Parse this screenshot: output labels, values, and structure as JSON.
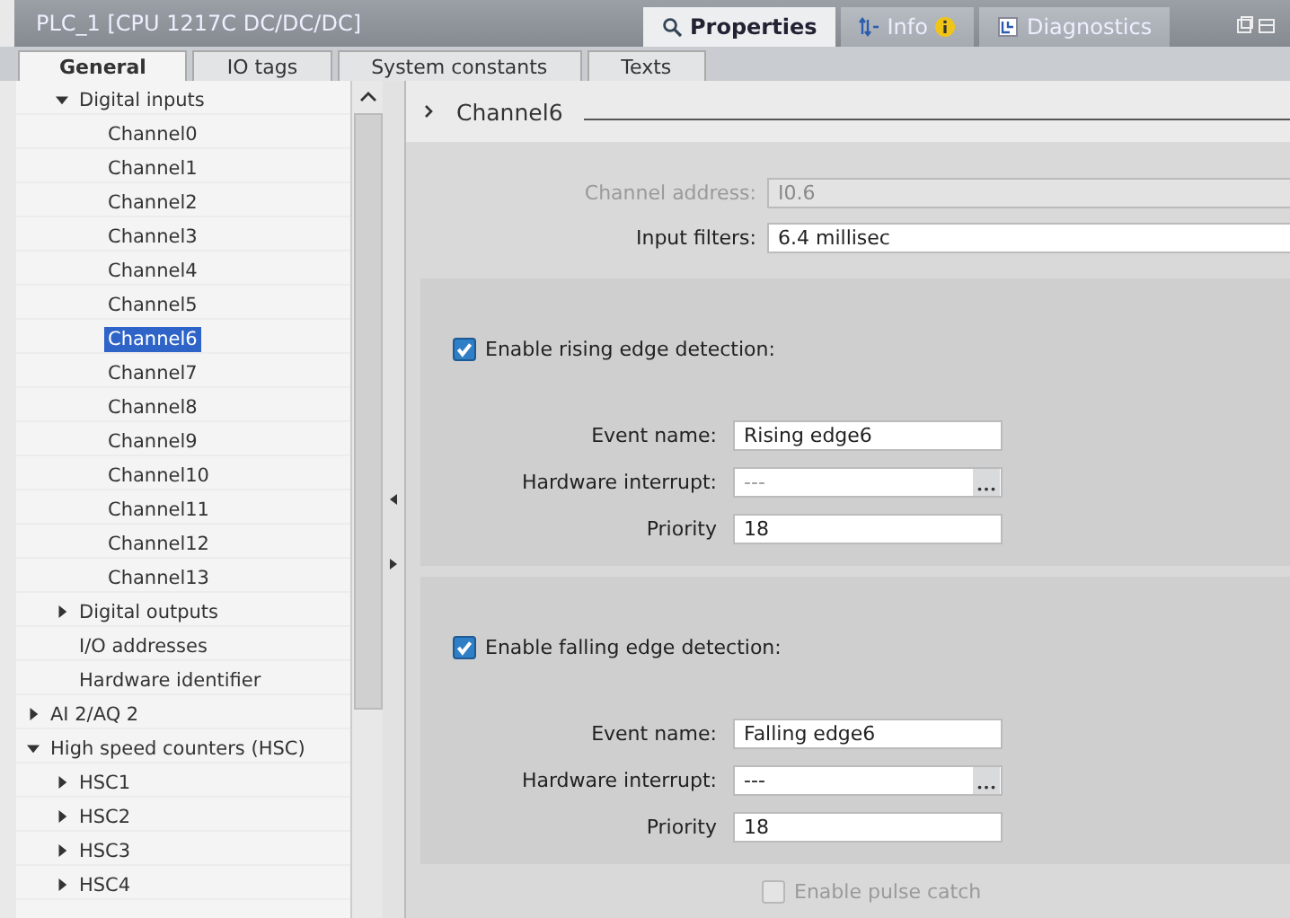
{
  "window": {
    "title": "PLC_1 [CPU 1217C DC/DC/DC]"
  },
  "inspector_tabs": [
    {
      "label": "Properties",
      "selected": true,
      "kind": "search"
    },
    {
      "label": "Info",
      "selected": false,
      "kind": "info"
    },
    {
      "label": "Diagnostics",
      "selected": false,
      "kind": "diag"
    }
  ],
  "tabs": [
    {
      "label": "General",
      "selected": true
    },
    {
      "label": "IO tags",
      "selected": false
    },
    {
      "label": "System constants",
      "selected": false
    },
    {
      "label": "Texts",
      "selected": false
    }
  ],
  "tree": {
    "items": [
      {
        "children": [
          {
            "label": "Digital inputs",
            "expanded": true,
            "selected": false,
            "children": [
              {
                "label": "Channel0",
                "selected": false
              },
              {
                "label": "Channel1",
                "selected": false
              },
              {
                "label": "Channel2",
                "selected": false
              },
              {
                "label": "Channel3",
                "selected": false
              },
              {
                "label": "Channel4",
                "selected": false
              },
              {
                "label": "Channel5",
                "selected": false
              },
              {
                "label": "Channel6",
                "selected": true
              },
              {
                "label": "Channel7",
                "selected": false
              },
              {
                "label": "Channel8",
                "selected": false
              },
              {
                "label": "Channel9",
                "selected": false
              },
              {
                "label": "Channel10",
                "selected": false
              },
              {
                "label": "Channel11",
                "selected": false
              },
              {
                "label": "Channel12",
                "selected": false
              },
              {
                "label": "Channel13",
                "selected": false
              }
            ]
          },
          {
            "label": "Digital outputs",
            "expanded": false,
            "selected": false
          },
          {
            "label": "I/O addresses",
            "selected": false
          },
          {
            "label": "Hardware identifier",
            "selected": false
          }
        ]
      },
      {
        "label": "AI 2/AQ 2",
        "expanded": false,
        "selected": false
      },
      {
        "label": "High speed counters (HSC)",
        "expanded": true,
        "selected": false,
        "children": [
          {
            "label": "HSC1",
            "expanded": false,
            "selected": false
          },
          {
            "label": "HSC2",
            "expanded": false,
            "selected": false
          },
          {
            "label": "HSC3",
            "expanded": false,
            "selected": false
          },
          {
            "label": "HSC4",
            "expanded": false,
            "selected": false
          }
        ]
      }
    ]
  },
  "section": {
    "title": "Channel6",
    "channel_address": {
      "label": "Channel address:",
      "value": "I0.6",
      "disabled": true
    },
    "input_filters": {
      "label": "Input filters:",
      "value": "6.4 millisec"
    },
    "groups": [
      {
        "checkbox": {
          "label": "Enable rising edge detection:",
          "checked": true
        },
        "event_name": {
          "label": "Event name:",
          "value": "Rising edge6"
        },
        "hardware_interrupt": {
          "label": "Hardware interrupt:",
          "value": "---",
          "disabled": true
        },
        "priority": {
          "label": "Priority",
          "value": "18"
        }
      },
      {
        "checkbox": {
          "label": "Enable falling edge detection:",
          "checked": true
        },
        "event_name": {
          "label": "Event name:",
          "value": "Falling edge6"
        },
        "hardware_interrupt": {
          "label": "Hardware interrupt:",
          "value": "---",
          "disabled": false
        },
        "priority": {
          "label": "Priority",
          "value": "18"
        }
      }
    ],
    "pulse_catch": {
      "label": "Enable pulse catch",
      "checked": false,
      "disabled": true
    }
  }
}
